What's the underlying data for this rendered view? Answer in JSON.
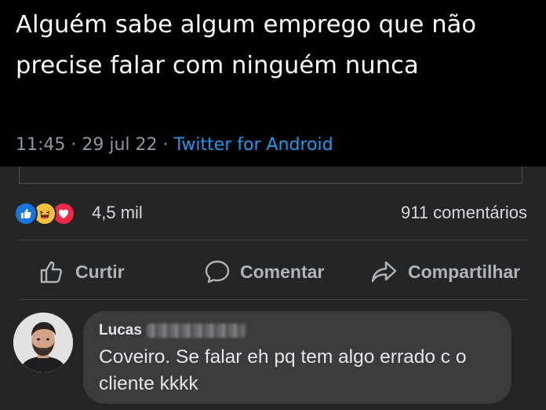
{
  "tweet": {
    "text": "Alguém sabe algum emprego que não precise falar com ninguém nunca",
    "time": "11:45",
    "separator": " · ",
    "date": "29 jul 22",
    "source": "Twitter for Android"
  },
  "reactions": {
    "icons": [
      "like-icon",
      "haha-icon",
      "love-icon"
    ],
    "count": "4,5 mil",
    "comments": "911 comentários"
  },
  "actions": {
    "like": "Curtir",
    "comment": "Comentar",
    "share": "Compartilhar"
  },
  "comment": {
    "author": "Lucas",
    "text": "Coveiro. Se falar eh pq tem algo errado c o cliente kkkk"
  },
  "colors": {
    "background": "#242526",
    "tweet_background": "#000000",
    "twitter_blue": "#1d9bf0",
    "like_blue": "#1b74e4",
    "love_red": "#f0284a",
    "haha_yellow": "#f7c03f",
    "bubble": "#3a3b3c"
  }
}
